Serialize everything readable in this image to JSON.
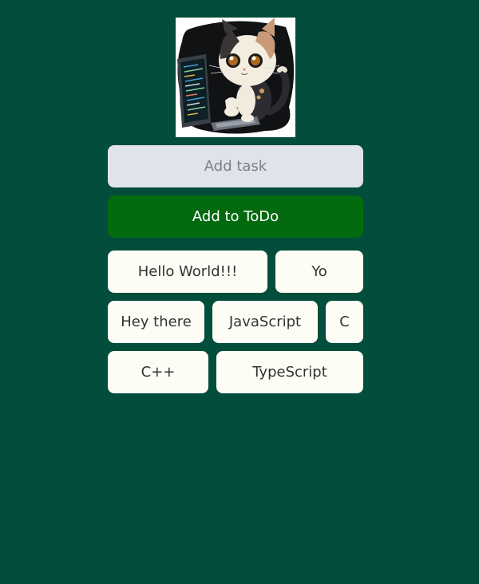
{
  "logo": {
    "icon": "cat-with-laptop-icon"
  },
  "task_input": {
    "placeholder": "Add task",
    "value": ""
  },
  "add_button": {
    "label": "Add to ToDo"
  },
  "todos": [
    {
      "label": "Hello World!!!"
    },
    {
      "label": "Yo"
    },
    {
      "label": "Hey there"
    },
    {
      "label": "JavaScript"
    },
    {
      "label": "C"
    },
    {
      "label": "C++"
    },
    {
      "label": "TypeScript"
    }
  ],
  "colors": {
    "background": "#024d3b",
    "input_background": "#dfe3ec",
    "button_background": "#046a0f",
    "item_background": "#fdfdf6"
  }
}
